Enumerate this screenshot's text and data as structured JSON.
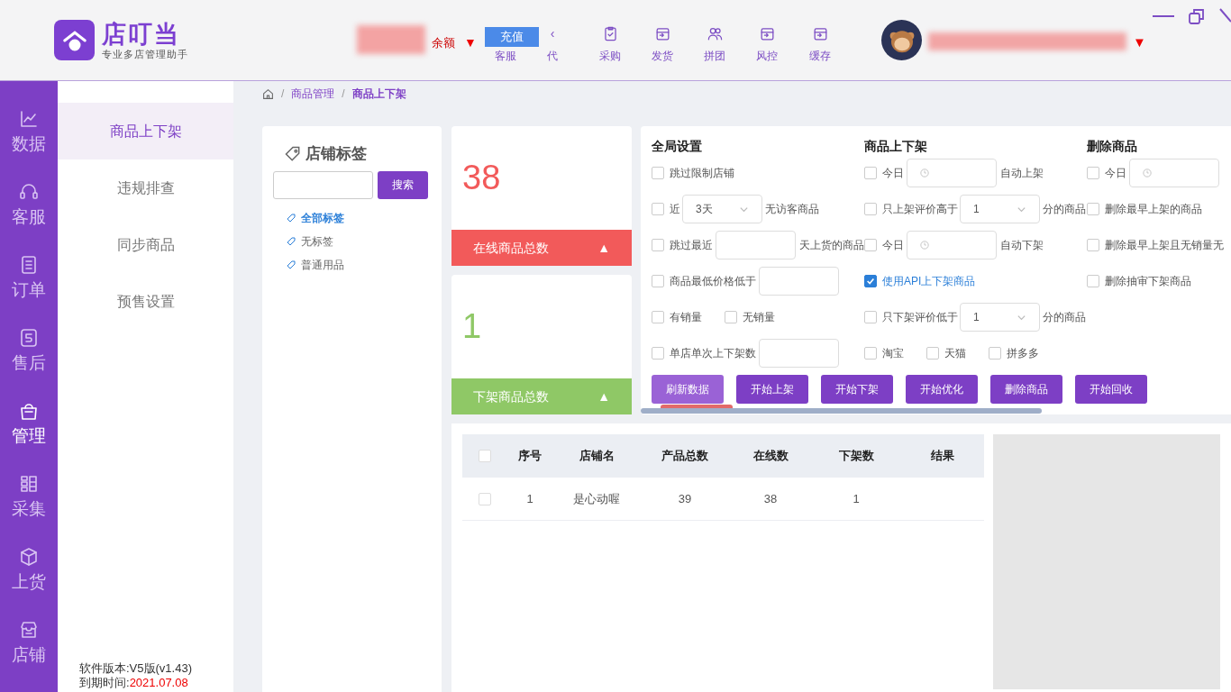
{
  "app": {
    "logo_name": "店叮当",
    "logo_tagline": "专业多店管理助手"
  },
  "header": {
    "balance_label": "余额",
    "balance_caret": "▼",
    "recharge_button": "充值",
    "nav": [
      {
        "label": "客服"
      },
      {
        "label": "代",
        "glyph": "‹"
      },
      {
        "label": "采购"
      },
      {
        "label": "发货"
      },
      {
        "label": "拼团"
      },
      {
        "label": "风控"
      },
      {
        "label": "缓存"
      }
    ],
    "user_caret": "▼"
  },
  "sidebar": {
    "items": [
      {
        "label": "数据",
        "selected": false
      },
      {
        "label": "客服",
        "selected": false
      },
      {
        "label": "订单",
        "selected": false
      },
      {
        "label": "售后",
        "selected": false
      },
      {
        "label": "管理",
        "selected": true
      },
      {
        "label": "采集",
        "selected": false
      },
      {
        "label": "上货",
        "selected": false
      },
      {
        "label": "店铺",
        "selected": false
      }
    ]
  },
  "submenu": {
    "items": [
      {
        "label": "商品上下架",
        "selected": true
      },
      {
        "label": "违规排查",
        "selected": false
      },
      {
        "label": "同步商品",
        "selected": false
      },
      {
        "label": "预售设置",
        "selected": false
      }
    ],
    "version": "软件版本:V5版(v1.43)",
    "expiry_label": "到期时间:",
    "expiry_value": "2021.07.08"
  },
  "breadcrumb": [
    {
      "kind": "separator",
      "text": "/"
    },
    {
      "kind": "link",
      "text": "商品管理"
    },
    {
      "kind": "separator",
      "text": "/"
    },
    {
      "kind": "current",
      "text": "商品上下架"
    }
  ],
  "tags": {
    "title": "店铺标签",
    "search_button": "搜索",
    "items": [
      {
        "label": "全部标签",
        "selected": true
      },
      {
        "label": "无标签",
        "selected": false
      },
      {
        "label": "普通用品",
        "selected": false
      }
    ]
  },
  "stats": [
    {
      "value": "38",
      "label": "在线商品总数",
      "arrow": "▲",
      "color": "#f25a5a"
    },
    {
      "value": "1",
      "label": "下架商品总数",
      "arrow": "▲",
      "color": "#8fc866"
    }
  ],
  "settings": {
    "columns": [
      {
        "title": "全局设置",
        "items": [
          {
            "controls": [
              {
                "kind": "checkbox",
                "checked": false,
                "label": "跳过限制店铺"
              }
            ]
          },
          {
            "controls": [
              {
                "kind": "checkbox",
                "checked": false,
                "label": "近"
              },
              {
                "kind": "select",
                "value": "3天"
              },
              {
                "kind": "text",
                "text": "无访客商品"
              }
            ]
          },
          {
            "controls": [
              {
                "kind": "checkbox",
                "checked": false,
                "label": "跳过最近"
              },
              {
                "kind": "input"
              },
              {
                "kind": "text",
                "text": "天上货的商品"
              }
            ]
          },
          {
            "controls": [
              {
                "kind": "checkbox",
                "checked": false,
                "label": "商品最低价格低于"
              },
              {
                "kind": "input"
              }
            ]
          },
          {
            "controls": [
              {
                "kind": "checkbox",
                "checked": false,
                "label": "有销量"
              },
              {
                "kind": "checkbox",
                "checked": false,
                "label": "无销量"
              }
            ]
          },
          {
            "controls": [
              {
                "kind": "checkbox",
                "checked": false,
                "label": "单店单次上下架数"
              },
              {
                "kind": "input"
              }
            ]
          }
        ]
      },
      {
        "title": "商品上下架",
        "items": [
          {
            "controls": [
              {
                "kind": "checkbox",
                "checked": false,
                "label": "今日"
              },
              {
                "kind": "time"
              },
              {
                "kind": "text",
                "text": "自动上架"
              }
            ]
          },
          {
            "controls": [
              {
                "kind": "checkbox",
                "checked": false,
                "label": "只上架评价高于"
              },
              {
                "kind": "select",
                "value": "1"
              },
              {
                "kind": "text",
                "text": "分的商品"
              }
            ]
          },
          {
            "controls": [
              {
                "kind": "checkbox",
                "checked": false,
                "label": "今日"
              },
              {
                "kind": "time"
              },
              {
                "kind": "text",
                "text": "自动下架"
              }
            ]
          },
          {
            "controls": [
              {
                "kind": "checkbox",
                "checked": true,
                "label": "使用API上下架商品"
              }
            ]
          },
          {
            "controls": [
              {
                "kind": "checkbox",
                "checked": false,
                "label": "只下架评价低于"
              },
              {
                "kind": "select",
                "value": "1"
              },
              {
                "kind": "text",
                "text": "分的商品"
              }
            ]
          },
          {
            "controls": [
              {
                "kind": "checkbox",
                "checked": false,
                "label": "淘宝"
              },
              {
                "kind": "checkbox",
                "checked": false,
                "label": "天猫"
              },
              {
                "kind": "checkbox",
                "checked": false,
                "label": "拼多多"
              }
            ]
          }
        ]
      },
      {
        "title": "删除商品",
        "items": [
          {
            "controls": [
              {
                "kind": "checkbox",
                "checked": false,
                "label": "今日"
              },
              {
                "kind": "time"
              }
            ]
          },
          {
            "controls": [
              {
                "kind": "checkbox",
                "checked": false,
                "label": "删除最早上架的商品"
              }
            ]
          },
          {
            "controls": [
              {
                "kind": "checkbox",
                "checked": false,
                "label": "删除最早上架且无销量无"
              }
            ]
          },
          {
            "controls": [
              {
                "kind": "checkbox",
                "checked": false,
                "label": "删除抽审下架商品"
              }
            ]
          }
        ]
      }
    ],
    "buttons": [
      {
        "label": "刷新数据",
        "kind": "light"
      },
      {
        "label": "开始上架",
        "kind": "primary"
      },
      {
        "label": "开始下架",
        "kind": "primary"
      },
      {
        "label": "开始优化",
        "kind": "primary"
      },
      {
        "label": "删除商品",
        "kind": "primary"
      },
      {
        "label": "开始回收",
        "kind": "primary"
      }
    ]
  },
  "table": {
    "all_selected": false,
    "columns": [
      "序号",
      "店铺名",
      "产品总数",
      "在线数",
      "下架数",
      "结果"
    ],
    "rows": [
      {
        "selected": false,
        "cells": [
          "1",
          "是心动喔",
          "39",
          "38",
          "1"
        ]
      }
    ]
  }
}
